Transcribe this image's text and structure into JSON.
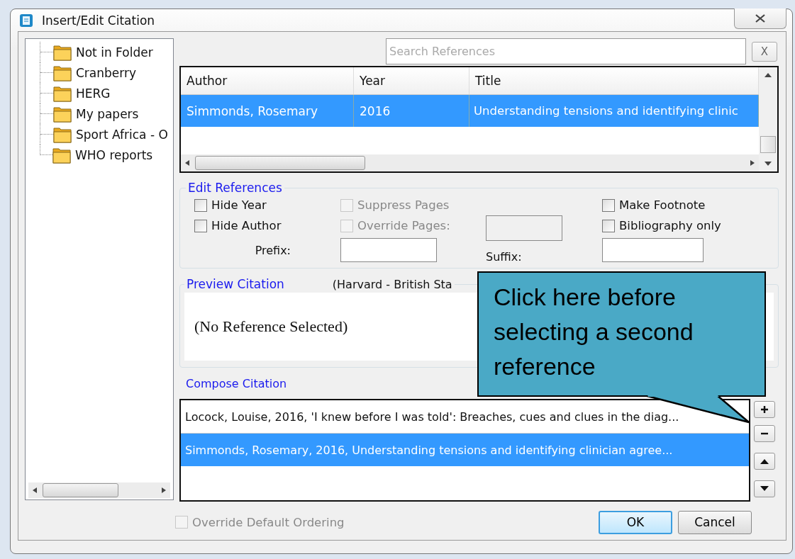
{
  "window": {
    "title": "Insert/Edit Citation"
  },
  "folders": [
    {
      "label": "Not in Folder"
    },
    {
      "label": "Cranberry"
    },
    {
      "label": "HERG"
    },
    {
      "label": "My papers"
    },
    {
      "label": "Sport Africa - O"
    },
    {
      "label": "WHO reports"
    }
  ],
  "search": {
    "placeholder": "Search References",
    "clear_label": "X"
  },
  "references": {
    "columns": [
      "Author",
      "Year",
      "Title"
    ],
    "rows": [
      {
        "cells": [
          "Simmonds, Rosemary",
          "2016",
          "Understanding tensions and identifying clinic"
        ],
        "selected": true
      }
    ]
  },
  "edit_references": {
    "title": "Edit References",
    "checkboxes": [
      {
        "label": "Hide Year",
        "checked": false,
        "disabled": false
      },
      {
        "label": "Hide Author",
        "checked": false,
        "disabled": false
      },
      {
        "label": "Suppress Pages",
        "checked": false,
        "disabled": true
      },
      {
        "label": "Override Pages:",
        "checked": false,
        "disabled": true
      },
      {
        "label": "Make Footnote",
        "checked": false,
        "disabled": false
      },
      {
        "label": "Bibliography only",
        "checked": false,
        "disabled": false
      }
    ],
    "pages_field": {
      "disabled": true
    },
    "prefix_label": "Prefix:",
    "suffix_label": "Suffix:"
  },
  "preview": {
    "title": "Preview Citation",
    "style": "(Harvard - British Sta",
    "text": "(No Reference Selected)"
  },
  "compose": {
    "title": "Compose Citation",
    "items": [
      {
        "text": "Locock, Louise, 2016, 'I knew before I was told': Breaches, cues and clues in the diag...",
        "selected": false
      },
      {
        "text": "Simmonds, Rosemary, 2016, Understanding tensions and identifying clinician agree...",
        "selected": true
      }
    ]
  },
  "override_ordering": {
    "label": "Override Default Ordering",
    "checked": false,
    "disabled": true
  },
  "buttons": [
    {
      "label": "OK",
      "default": true
    },
    {
      "label": "Cancel",
      "default": false
    }
  ],
  "callout": {
    "text": "Click here before selecting a second reference"
  }
}
